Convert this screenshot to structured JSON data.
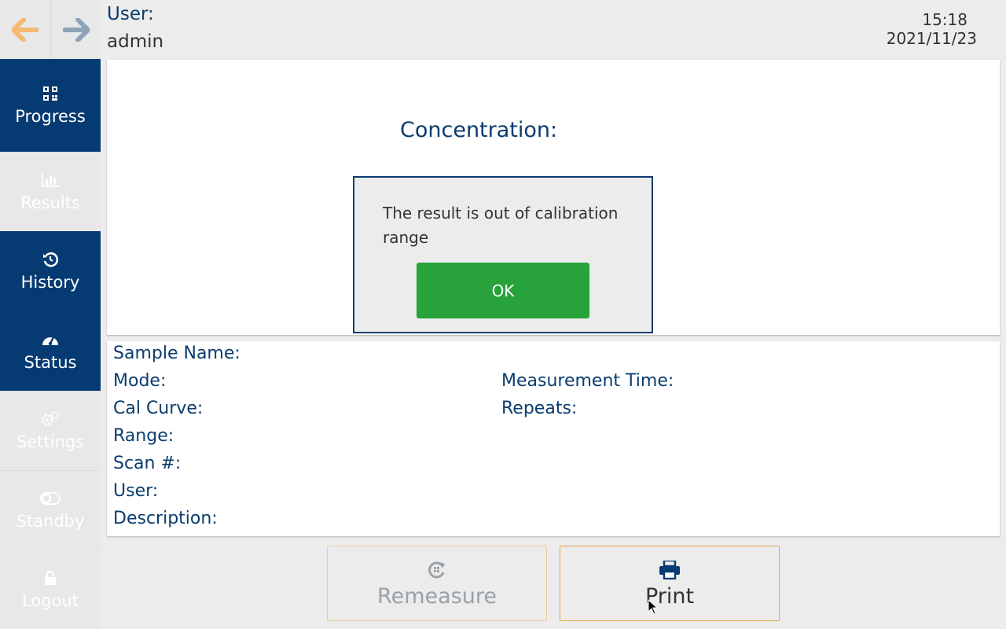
{
  "header": {
    "user_label": "User:",
    "user_name": "admin",
    "time": "15:18",
    "date": "2021/11/23"
  },
  "nav": {
    "back_icon": "arrow-left-icon",
    "forward_icon": "arrow-right-icon",
    "back_color": "#f5b974",
    "forward_color": "#8fa3b8"
  },
  "sidebar": {
    "items": [
      {
        "label": "Progress",
        "icon": "qr-code-icon",
        "state": "active"
      },
      {
        "label": "Results",
        "icon": "bar-chart-icon",
        "state": "disabled"
      },
      {
        "label": "History",
        "icon": "history-icon",
        "state": "active"
      },
      {
        "label": "Status",
        "icon": "gauge-icon",
        "state": "active"
      },
      {
        "label": "Settings",
        "icon": "gears-icon",
        "state": "disabled"
      },
      {
        "label": "Standby",
        "icon": "toggle-icon",
        "state": "disabled"
      },
      {
        "label": "Logout",
        "icon": "lock-icon",
        "state": "disabled"
      }
    ]
  },
  "result": {
    "concentration_label": "Concentration:"
  },
  "dialog": {
    "message": "The result is out of calibration range",
    "ok_label": "OK"
  },
  "details": {
    "sample_name": "Sample Name:",
    "mode": "Mode:",
    "cal_curve": "Cal Curve:",
    "range": "Range:",
    "scan": "Scan #:",
    "user": "User:",
    "description": "Description:",
    "measurement_time": "Measurement Time:",
    "repeats": "Repeats:"
  },
  "actions": {
    "remeasure_label": "Remeasure",
    "print_label": "Print"
  },
  "colors": {
    "accent": "#063a72",
    "ok_green": "#28a23a",
    "button_border": "#e8a552"
  }
}
